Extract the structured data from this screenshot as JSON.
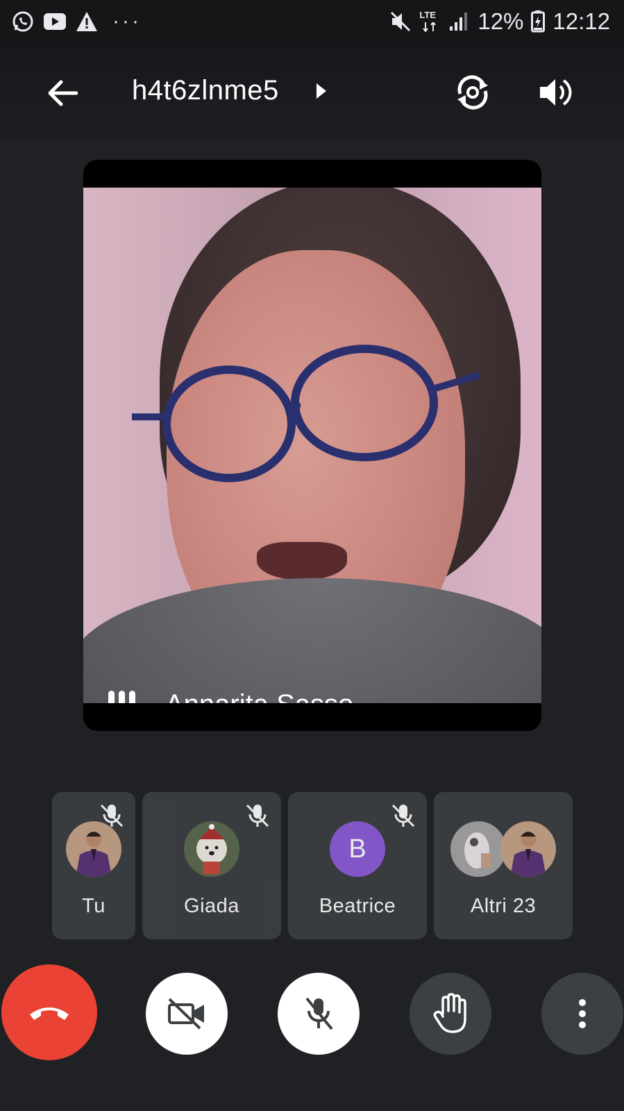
{
  "status_bar": {
    "icons_left": [
      "whatsapp-icon",
      "youtube-icon",
      "warning-icon"
    ],
    "more": "···",
    "network": "LTE",
    "battery": "12%",
    "time": "12:12"
  },
  "header": {
    "meeting_code": "h4t6zlnme5"
  },
  "main_speaker": {
    "name": "Annarita Sasso"
  },
  "participants": [
    {
      "name": "Tu",
      "muted": true
    },
    {
      "name": "Giada",
      "muted": true
    },
    {
      "name": "Beatrice",
      "initial": "B",
      "muted": true,
      "avatar_color": "#8e5cd9"
    },
    {
      "name": "Altri 23"
    }
  ],
  "controls": {
    "end_call_color": "#ea4335"
  }
}
